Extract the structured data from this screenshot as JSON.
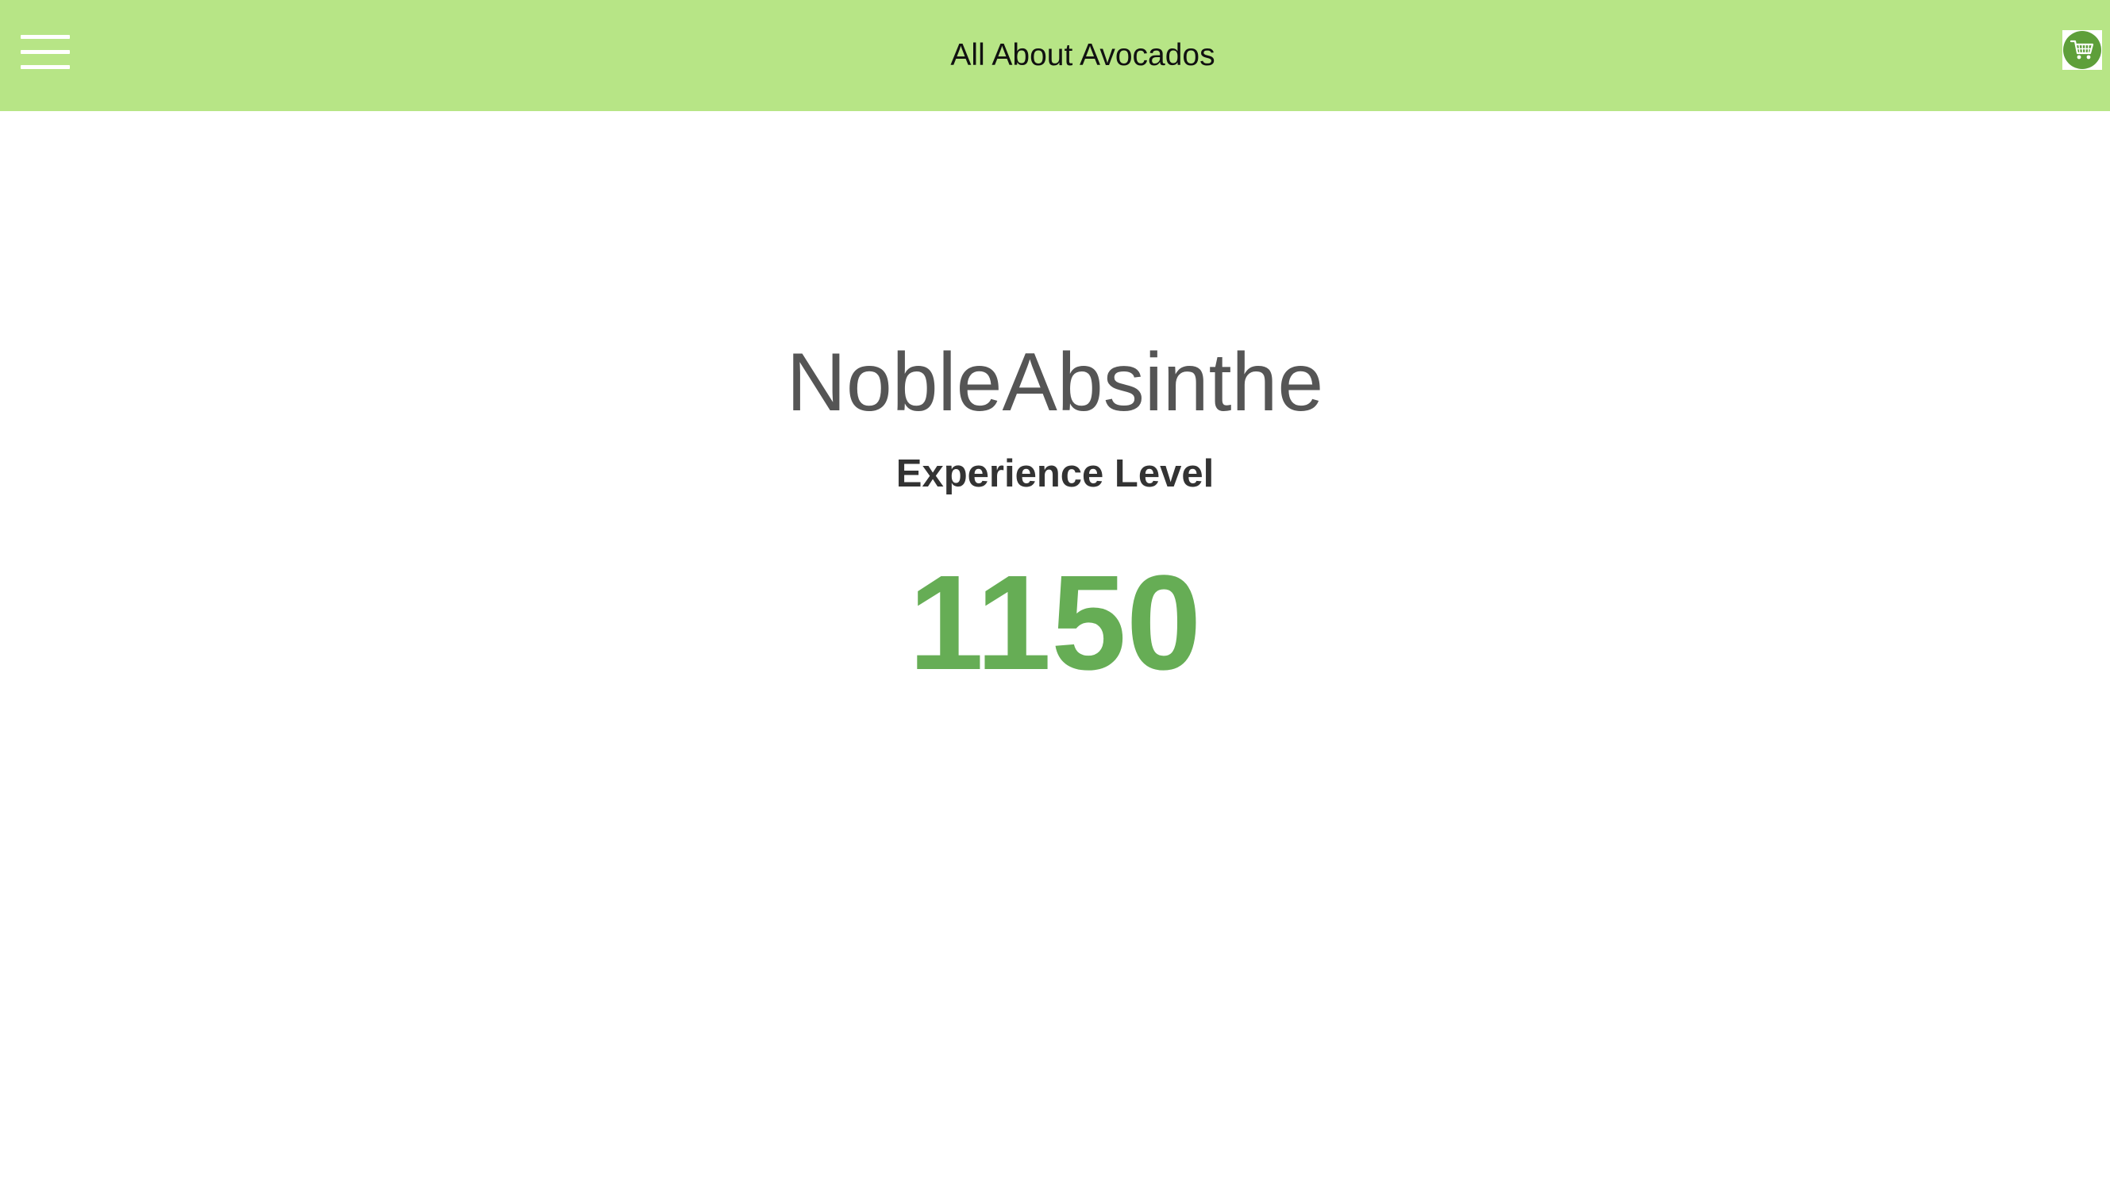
{
  "header": {
    "title": "All About Avocados",
    "menu_icon": "hamburger-menu-icon",
    "cart_icon": "shopping-cart-icon",
    "background_color": "#b7e586",
    "cart_color": "#5e9f3a"
  },
  "profile": {
    "username": "NobleAbsinthe",
    "experience_label": "Experience Level",
    "experience_value": "1150",
    "value_color": "#66ad55"
  }
}
